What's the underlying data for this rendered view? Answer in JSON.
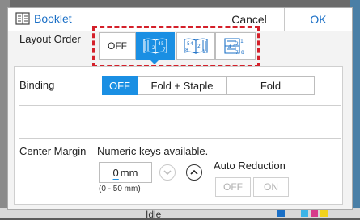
{
  "background": {
    "status_text": "Idle"
  },
  "dialog": {
    "title": "Booklet",
    "cancel_label": "Cancel",
    "ok_label": "OK",
    "title_icon": "booklet-icon"
  },
  "layout_order": {
    "label": "Layout Order",
    "options": [
      "OFF",
      "left-binding-order",
      "right-binding-order",
      "top-binding-order"
    ],
    "off_label": "OFF",
    "selected": "left-binding-order",
    "highlight_color": "#d4202a",
    "selected_color": "#1a8fe3"
  },
  "binding": {
    "label": "Binding",
    "options": [
      "OFF",
      "Fold + Staple",
      "Fold"
    ],
    "selected": "OFF"
  },
  "center_margin": {
    "label": "Center Margin",
    "hint": "Numeric keys available.",
    "value": "0",
    "unit": "mm",
    "range": "(0 - 50 mm)"
  },
  "auto_reduction": {
    "label": "Auto Reduction",
    "options": [
      "OFF",
      "ON"
    ],
    "enabled": false
  }
}
